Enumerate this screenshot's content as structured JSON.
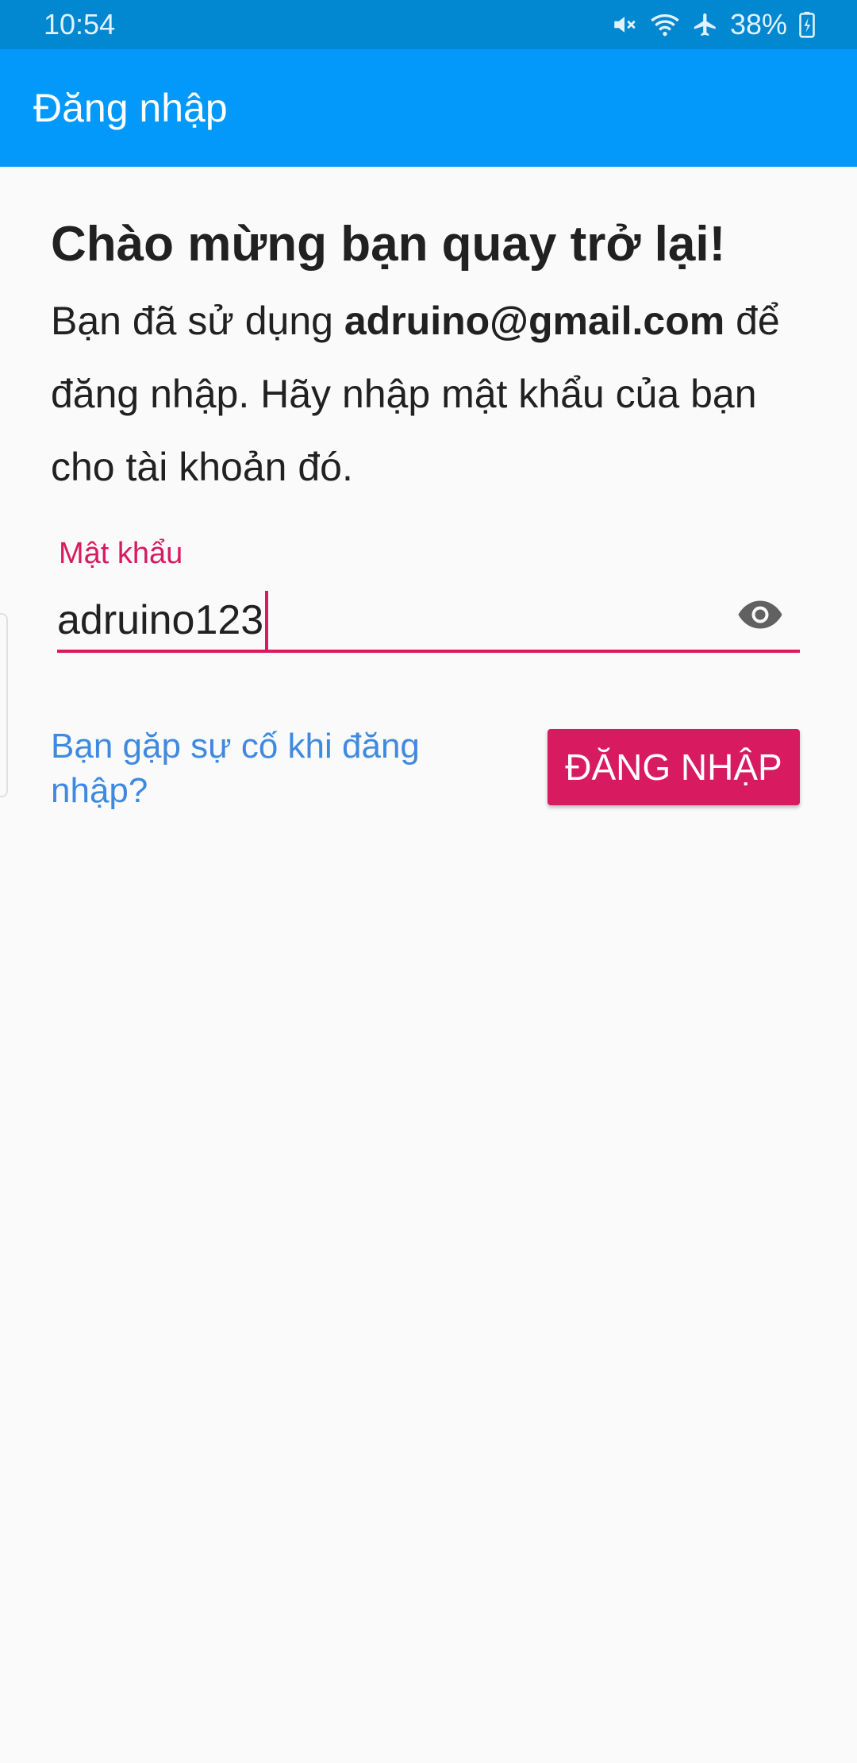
{
  "status_bar": {
    "time": "10:54",
    "battery": "38%",
    "icons": [
      "mute-icon",
      "wifi-icon",
      "airplane-icon",
      "battery-charging-icon"
    ]
  },
  "app_bar": {
    "title": "Đăng nhập"
  },
  "welcome": {
    "title": "Chào mừng bạn quay trở lại!",
    "body_prefix": "Bạn đã sử dụng ",
    "email": "adruino@gmail.com",
    "body_suffix": " để đăng nhập. Hãy nhập mật khẩu của bạn cho tài khoản đó."
  },
  "password_field": {
    "label": "Mật khẩu",
    "value": "adruino123",
    "toggle_icon": "eye-icon"
  },
  "actions": {
    "trouble_link": "Bạn gặp sự cố khi đăng nhập?",
    "login_button": "ĐĂNG NHẬP"
  },
  "colors": {
    "status_bar": "#0288d1",
    "app_bar": "#0399fb",
    "accent": "#d81b60",
    "link": "#3f8ae0"
  }
}
